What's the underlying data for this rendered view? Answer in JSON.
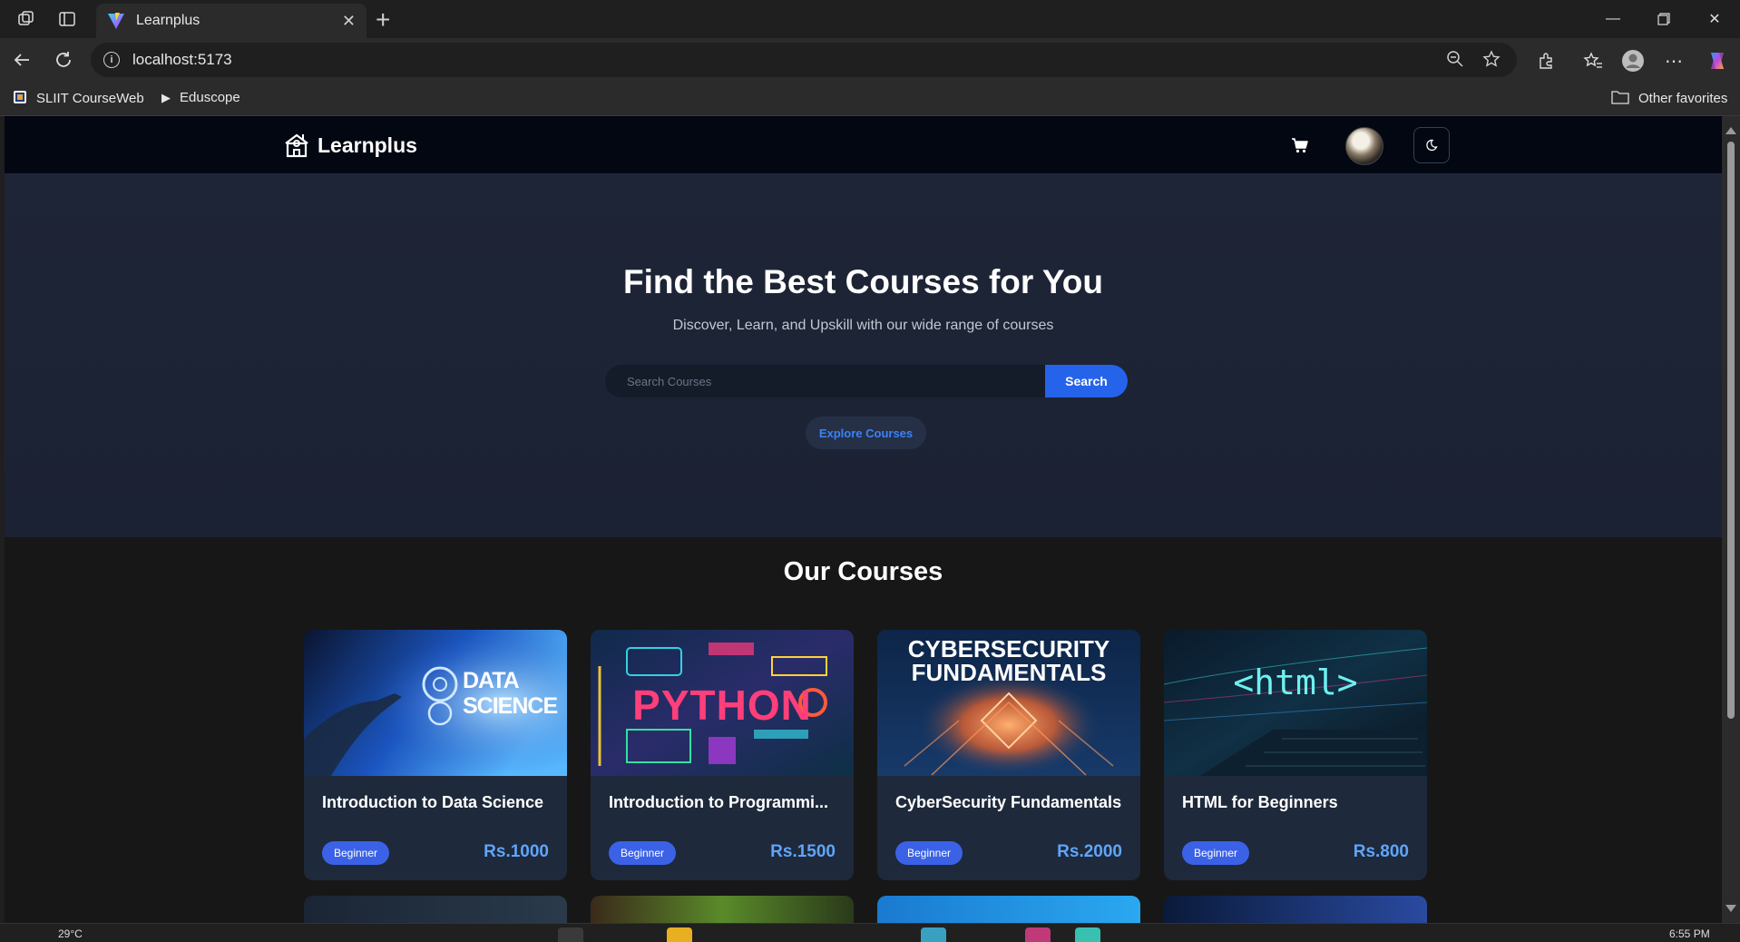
{
  "browser": {
    "tab_title": "Learnplus",
    "url": "localhost:5173",
    "bookmarks": [
      "SLIIT CourseWeb",
      "Eduscope"
    ],
    "other_favorites": "Other favorites"
  },
  "navbar": {
    "brand": "Learnplus"
  },
  "hero": {
    "title": "Find the Best Courses for You",
    "subtitle": "Discover, Learn, and Upskill with our wide range of courses",
    "search_placeholder": "Search Courses",
    "search_button": "Search",
    "explore_button": "Explore Courses"
  },
  "courses": {
    "heading": "Our Courses",
    "items": [
      {
        "title": "Introduction to Data Science",
        "level": "Beginner",
        "price": "Rs.1000",
        "image_text": "DATA SCIENCE"
      },
      {
        "title": "Introduction to Programmi...",
        "level": "Beginner",
        "price": "Rs.1500",
        "image_text": "PYTHON"
      },
      {
        "title": "CyberSecurity Fundamentals",
        "level": "Beginner",
        "price": "Rs.2000",
        "image_text": "CYBERSECURITY FUNDAMENTALS"
      },
      {
        "title": "HTML for Beginners",
        "level": "Beginner",
        "price": "Rs.800",
        "image_text": "<html>"
      }
    ]
  },
  "taskbar": {
    "temperature": "29°C",
    "time": "6:55 PM"
  },
  "colors": {
    "accent": "#2563eb",
    "price": "#60a5fa",
    "badge": "#3b62e6",
    "navbar": "#030712",
    "hero_bg": "#1e2537",
    "card_bg": "#1e293b"
  }
}
